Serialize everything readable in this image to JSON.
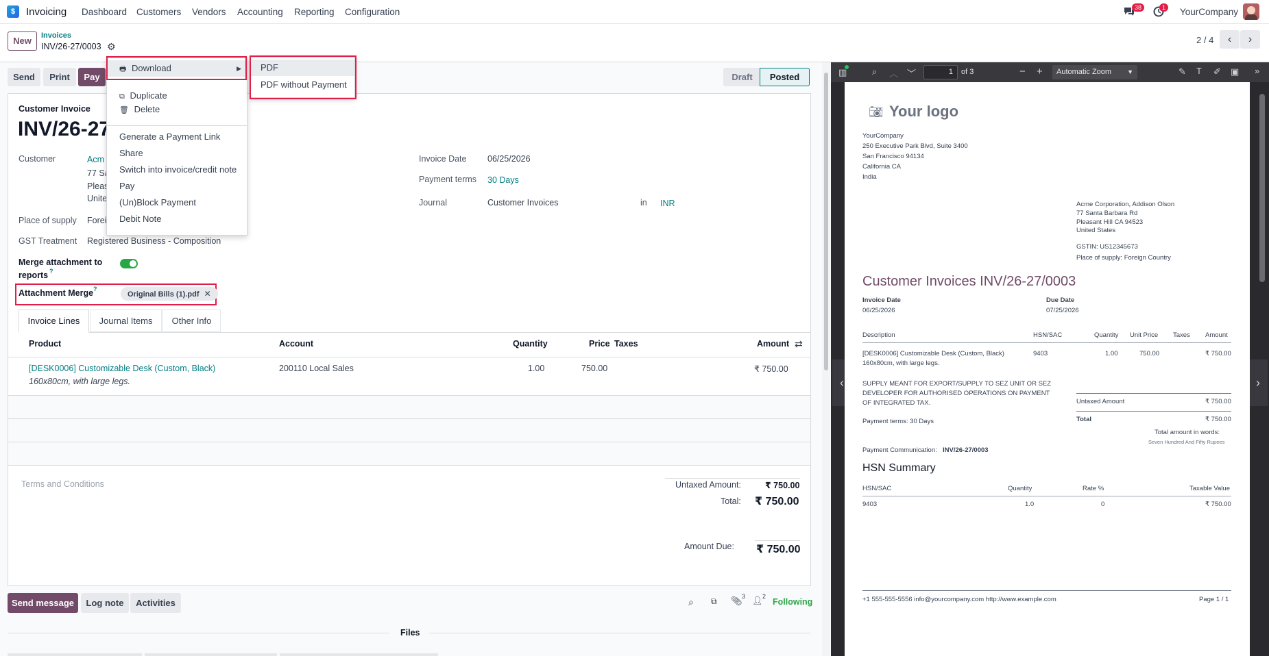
{
  "nav": {
    "app_name": "Invoicing",
    "menu": [
      "Dashboard",
      "Customers",
      "Vendors",
      "Accounting",
      "Reporting",
      "Configuration"
    ],
    "messages_count": "38",
    "activities_count": "1",
    "company": "YourCompany"
  },
  "control": {
    "new_label": "New",
    "breadcrumb_parent": "Invoices",
    "breadcrumb_current": "INV/26-27/0003",
    "pager": "2 / 4"
  },
  "actions": {
    "send": "Send",
    "print": "Print",
    "pay": "Pay"
  },
  "status": {
    "draft": "Draft",
    "posted": "Posted"
  },
  "gear_menu": {
    "download": "Download",
    "duplicate": "Duplicate",
    "delete": "Delete",
    "items": [
      "Generate a Payment Link",
      "Share",
      "Switch into invoice/credit note",
      "Pay",
      "(Un)Block Payment",
      "Debit Note"
    ]
  },
  "download_menu": {
    "items": [
      "PDF",
      "PDF without Payment"
    ]
  },
  "form": {
    "type_label": "Customer Invoice",
    "number_visible": "INV/26-27",
    "customer_label": "Customer",
    "customer_name": "Acm",
    "customer_addr": [
      "77 Sa",
      "Pleas",
      "Unite"
    ],
    "place_label": "Place of supply",
    "place_value": "Forei",
    "gst_label": "GST Treatment",
    "gst_value": "Registered Business - Composition",
    "merge_label_1": "Merge attachment to",
    "merge_label_2": "reports",
    "merge_help": "?",
    "attach_label": "Attachment Merge",
    "attach_help": "?",
    "attach_tag": "Original Bills (1).pdf",
    "invoice_date_label": "Invoice Date",
    "invoice_date": "06/25/2026",
    "terms_label": "Payment terms",
    "terms_value": "30 Days",
    "journal_label": "Journal",
    "journal_value": "Customer Invoices",
    "in_label": "in",
    "currency": "INR"
  },
  "tabs": [
    "Invoice Lines",
    "Journal Items",
    "Other Info"
  ],
  "lines": {
    "headers": {
      "product": "Product",
      "account": "Account",
      "quantity": "Quantity",
      "price": "Price",
      "taxes": "Taxes",
      "amount": "Amount"
    },
    "rows": [
      {
        "product": "[DESK0006] Customizable Desk (Custom, Black)",
        "description": "160x80cm, with large legs.",
        "account": "200110 Local Sales",
        "quantity": "1.00",
        "price": "750.00",
        "amount": "₹ 750.00"
      }
    ]
  },
  "totals": {
    "terms_placeholder": "Terms and Conditions",
    "untaxed_label": "Untaxed Amount:",
    "untaxed": "₹ 750.00",
    "total_label": "Total:",
    "total": "₹ 750.00",
    "due_label": "Amount Due:",
    "due": "₹ 750.00"
  },
  "chatter": {
    "send_message": "Send message",
    "log_note": "Log note",
    "activities": "Activities",
    "attachments_count": "3",
    "followers_count": "2",
    "following": "Following",
    "files_label": "Files"
  },
  "pdf_toolbar": {
    "page": "1",
    "of_pages": "of 3",
    "zoom": "Automatic Zoom"
  },
  "pdf": {
    "logo": "Your logo",
    "company_lines": [
      "YourCompany",
      "250 Executive Park Blvd, Suite 3400",
      "San Francisco 94134",
      "California CA",
      "India"
    ],
    "customer_lines": [
      "Acme Corporation, Addison Olson",
      "77 Santa Barbara Rd",
      "Pleasant Hill CA 94523",
      "United States"
    ],
    "gstin": "GSTIN: US12345673",
    "place_of_supply": "Place of supply: Foreign Country",
    "title": "Customer Invoices INV/26-27/0003",
    "invoice_date_label": "Invoice Date",
    "invoice_date": "06/25/2026",
    "due_date_label": "Due Date",
    "due_date": "07/25/2026",
    "headers": [
      "Description",
      "HSN/SAC",
      "Quantity",
      "Unit Price",
      "Taxes",
      "Amount"
    ],
    "row": {
      "desc1": "[DESK0006] Customizable Desk (Custom, Black)",
      "desc2": "160x80cm, with large legs.",
      "hsn": "9403",
      "qty": "1.00",
      "price": "750.00",
      "amount": "₹ 750.00"
    },
    "notice": [
      "SUPPLY MEANT FOR EXPORT/SUPPLY TO SEZ UNIT OR SEZ",
      "DEVELOPER FOR AUTHORISED OPERATIONS ON PAYMENT",
      "OF INTEGRATED TAX."
    ],
    "untaxed_label": "Untaxed Amount",
    "untaxed": "₹ 750.00",
    "total_label": "Total",
    "total": "₹ 750.00",
    "payment_terms": "Payment terms: 30 Days",
    "words_label": "Total amount in words:",
    "words": "Seven Hundred And Fifty Rupees",
    "communication_label": "Payment Communication:",
    "communication": "INV/26-27/0003",
    "hsn_title": "HSN Summary",
    "hsn_headers": [
      "HSN/SAC",
      "Quantity",
      "Rate %",
      "Taxable Value"
    ],
    "hsn_row": [
      "9403",
      "1.0",
      "0",
      "₹ 750.00"
    ],
    "footer": "+1 555-555-5556 info@yourcompany.com http://www.example.com",
    "page_num": "Page 1 / 1"
  },
  "colors": {
    "brand": "#714b67",
    "teal": "#017e84",
    "highlight": "#e11d48",
    "toggle": "#28a745"
  }
}
